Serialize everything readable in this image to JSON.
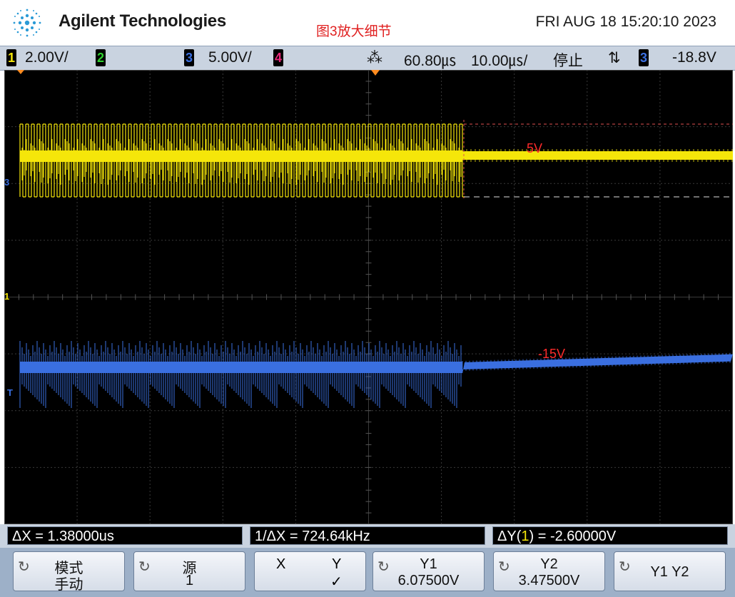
{
  "header": {
    "brand": "Agilent Technologies",
    "annotation": "图3放大细节",
    "datetime": "FRI AUG 18 15:20:10 2023"
  },
  "status": {
    "ch1_num": "1",
    "ch1_scale": "2.00V/",
    "ch2_num": "2",
    "ch3_num": "3",
    "ch3_scale": "5.00V/",
    "ch4_num": "4",
    "time_delay": "60.80㎲",
    "time_scale": "10.00㎲/",
    "run_state": "停止",
    "trigger_edge": "⇅",
    "trig_src_num": "3",
    "trig_level": "-18.8V"
  },
  "screen": {
    "label_top": "5V",
    "label_bottom": "-15V",
    "marker_ch3": "3",
    "marker_ch1": "1",
    "marker_trig": "T"
  },
  "readouts": {
    "delta_x": "ΔX = 1.38000us",
    "inv_delta_x": "1/ΔX = 724.64kHz",
    "delta_y_prefix": "ΔY(",
    "delta_y_ch": "1",
    "delta_y_suffix": ") = -2.60000V"
  },
  "softkeys": [
    {
      "l1": "模式",
      "l2": "手动"
    },
    {
      "l1": "源",
      "l2": "1"
    },
    {
      "x": "X",
      "y": "Y",
      "check": "✓"
    },
    {
      "l1": "Y1",
      "l2": "6.07500V"
    },
    {
      "l1": "Y2",
      "l2": "3.47500V"
    },
    {
      "l1": "Y1 Y2"
    }
  ],
  "colors": {
    "ch1": "#f5e60a",
    "ch2": "#2fd02f",
    "ch3": "#3a6fe0",
    "ch4": "#e8287a",
    "annotation": "#e02020"
  }
}
